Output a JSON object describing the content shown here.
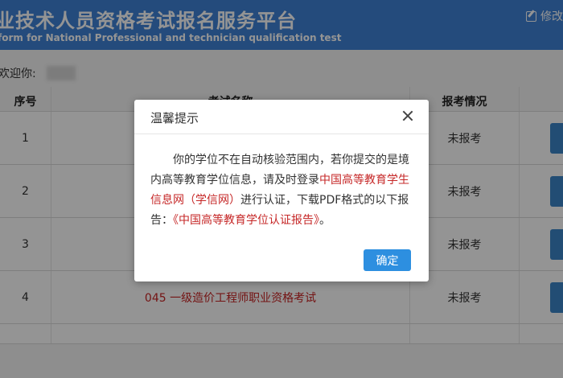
{
  "header": {
    "title": "业技术人员资格考试报名服务平台",
    "subtitle": "form for National Professional and technician qualification test",
    "modify_label": "修改",
    "modify_icon": "edit-icon",
    "bg_color": "#3f82d6"
  },
  "welcome": {
    "label": "欢迎你:"
  },
  "table": {
    "headers": [
      "序号",
      "考试名称",
      "报考情况"
    ],
    "rows": [
      {
        "index": "1",
        "name": "",
        "status": "未报考"
      },
      {
        "index": "2",
        "name": "",
        "status": "未报考"
      },
      {
        "index": "3",
        "name": "",
        "status": "未报考"
      },
      {
        "index": "4",
        "name": "045 一级造价工程师职业资格考试",
        "status": "未报考"
      }
    ]
  },
  "modal": {
    "title": "温馨提示",
    "body_1": "你的学位不在自动核验范围内，若你提交的是境内高等教育学位信息，请及时登录",
    "body_link": "中国高等教育学生信息网（学信网）",
    "body_2": "进行认证，下载PDF格式的以下报告：",
    "body_report": "《中国高等教育学位认证报告》",
    "body_end": "。",
    "confirm_label": "确定",
    "close_icon": "close-icon",
    "accent_color": "#2d8fe0",
    "highlight_color": "#c62828"
  }
}
